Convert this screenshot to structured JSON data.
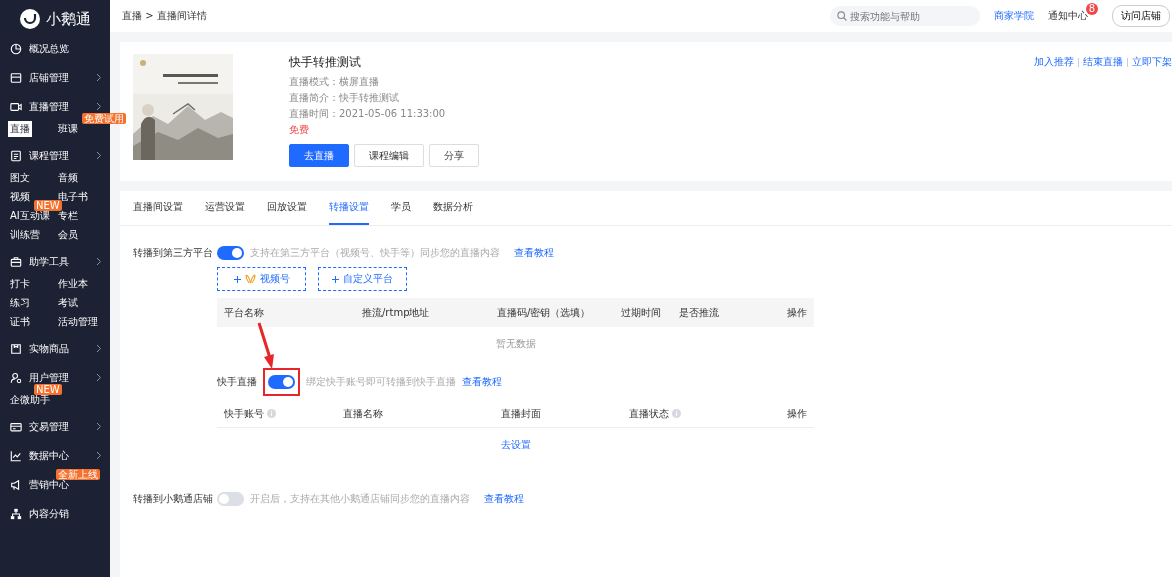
{
  "brand": {
    "name": "小鹅通"
  },
  "sidebar": {
    "groups": [
      {
        "label": "概况总览",
        "chevron": false
      },
      {
        "label": "店铺管理",
        "chevron": true
      },
      {
        "label": "直播管理",
        "chevron": true,
        "items": [
          {
            "label": "直播",
            "selected": true
          },
          {
            "label": "班课",
            "selected": false,
            "badge": "免费试用"
          }
        ]
      },
      {
        "label": "课程管理",
        "chevron": true,
        "items": [
          {
            "label": "图文",
            "selected": false
          },
          {
            "label": "音频",
            "selected": false
          },
          {
            "label": "视频",
            "selected": false
          },
          {
            "label": "电子书",
            "selected": false
          },
          {
            "label": "AI互动课",
            "selected": false,
            "badge": "NEW"
          },
          {
            "label": "专栏",
            "selected": false
          },
          {
            "label": "训练营",
            "selected": false
          },
          {
            "label": "会员",
            "selected": false
          }
        ]
      },
      {
        "label": "助学工具",
        "chevron": true,
        "items": [
          {
            "label": "打卡",
            "selected": false
          },
          {
            "label": "作业本",
            "selected": false
          },
          {
            "label": "练习",
            "selected": false
          },
          {
            "label": "考试",
            "selected": false
          },
          {
            "label": "证书",
            "selected": false
          },
          {
            "label": "活动管理",
            "selected": false
          }
        ]
      },
      {
        "label": "实物商品",
        "chevron": true
      },
      {
        "label": "用户管理",
        "chevron": true,
        "items": [
          {
            "label": "企微助手",
            "selected": false,
            "badge": "NEW"
          }
        ]
      },
      {
        "label": "交易管理",
        "chevron": true
      },
      {
        "label": "数据中心",
        "chevron": true
      },
      {
        "label": "营销中心",
        "chevron": false,
        "badge": "全新上线"
      },
      {
        "label": "内容分销",
        "chevron": false
      }
    ]
  },
  "header": {
    "breadcrumb": [
      "直播",
      "直播间详情"
    ],
    "separator": ">",
    "search": {
      "placeholder": "搜索功能与帮助"
    },
    "academy": "商家学院",
    "notice": {
      "label": "通知中心",
      "count": "8"
    },
    "visit": "访问店铺"
  },
  "live": {
    "title": "快手转推测试",
    "meta": [
      "直播模式：横屏直播",
      "直播简介：快手转推测试",
      "直播时间：2021-05-06 11:33:00"
    ],
    "price": "免费",
    "buttons": [
      {
        "label": "去直播",
        "kind": "primary"
      },
      {
        "label": "课程编辑",
        "kind": "default"
      },
      {
        "label": "分享",
        "kind": "default"
      }
    ],
    "actions": [
      "加入推荐",
      "结束直播",
      "立即下架"
    ]
  },
  "tabs": [
    {
      "label": "直播间设置",
      "selected": false
    },
    {
      "label": "运营设置",
      "selected": false
    },
    {
      "label": "回放设置",
      "selected": false
    },
    {
      "label": "转播设置",
      "selected": true
    },
    {
      "label": "学员",
      "selected": false
    },
    {
      "label": "数据分析",
      "selected": false
    }
  ],
  "third_party": {
    "label": "转播到第三方平台",
    "on": true,
    "hint": "支持在第三方平台（视频号、快手等）同步您的直播内容",
    "link": "查看教程",
    "add_buttons": [
      {
        "label": "视频号",
        "kind": "channels"
      },
      {
        "label": "自定义平台",
        "kind": "plain"
      }
    ],
    "table": {
      "columns": [
        {
          "label": "平台名称"
        },
        {
          "label": "推流/rtmp地址"
        },
        {
          "label": "直播码/密钥（选填）"
        },
        {
          "label": "过期时间"
        },
        {
          "label": "是否推流"
        },
        {
          "label": "操作"
        }
      ],
      "empty_text": "暂无数据"
    }
  },
  "kuaishou": {
    "label": "快手直播",
    "on": true,
    "hint": "绑定快手账号即可转播到快手直播",
    "link": "查看教程",
    "table": {
      "columns": [
        {
          "label": "快手账号",
          "info": true
        },
        {
          "label": "直播名称",
          "info": false
        },
        {
          "label": "直播封面",
          "info": false
        },
        {
          "label": "直播状态",
          "info": true
        },
        {
          "label": "操作",
          "info": false
        }
      ],
      "empty_link": "去设置"
    }
  },
  "store": {
    "label": "转播到小鹅通店铺",
    "on": false,
    "hint": "开启后，支持在其他小鹅通店铺同步您的直播内容",
    "link": "查看教程"
  }
}
